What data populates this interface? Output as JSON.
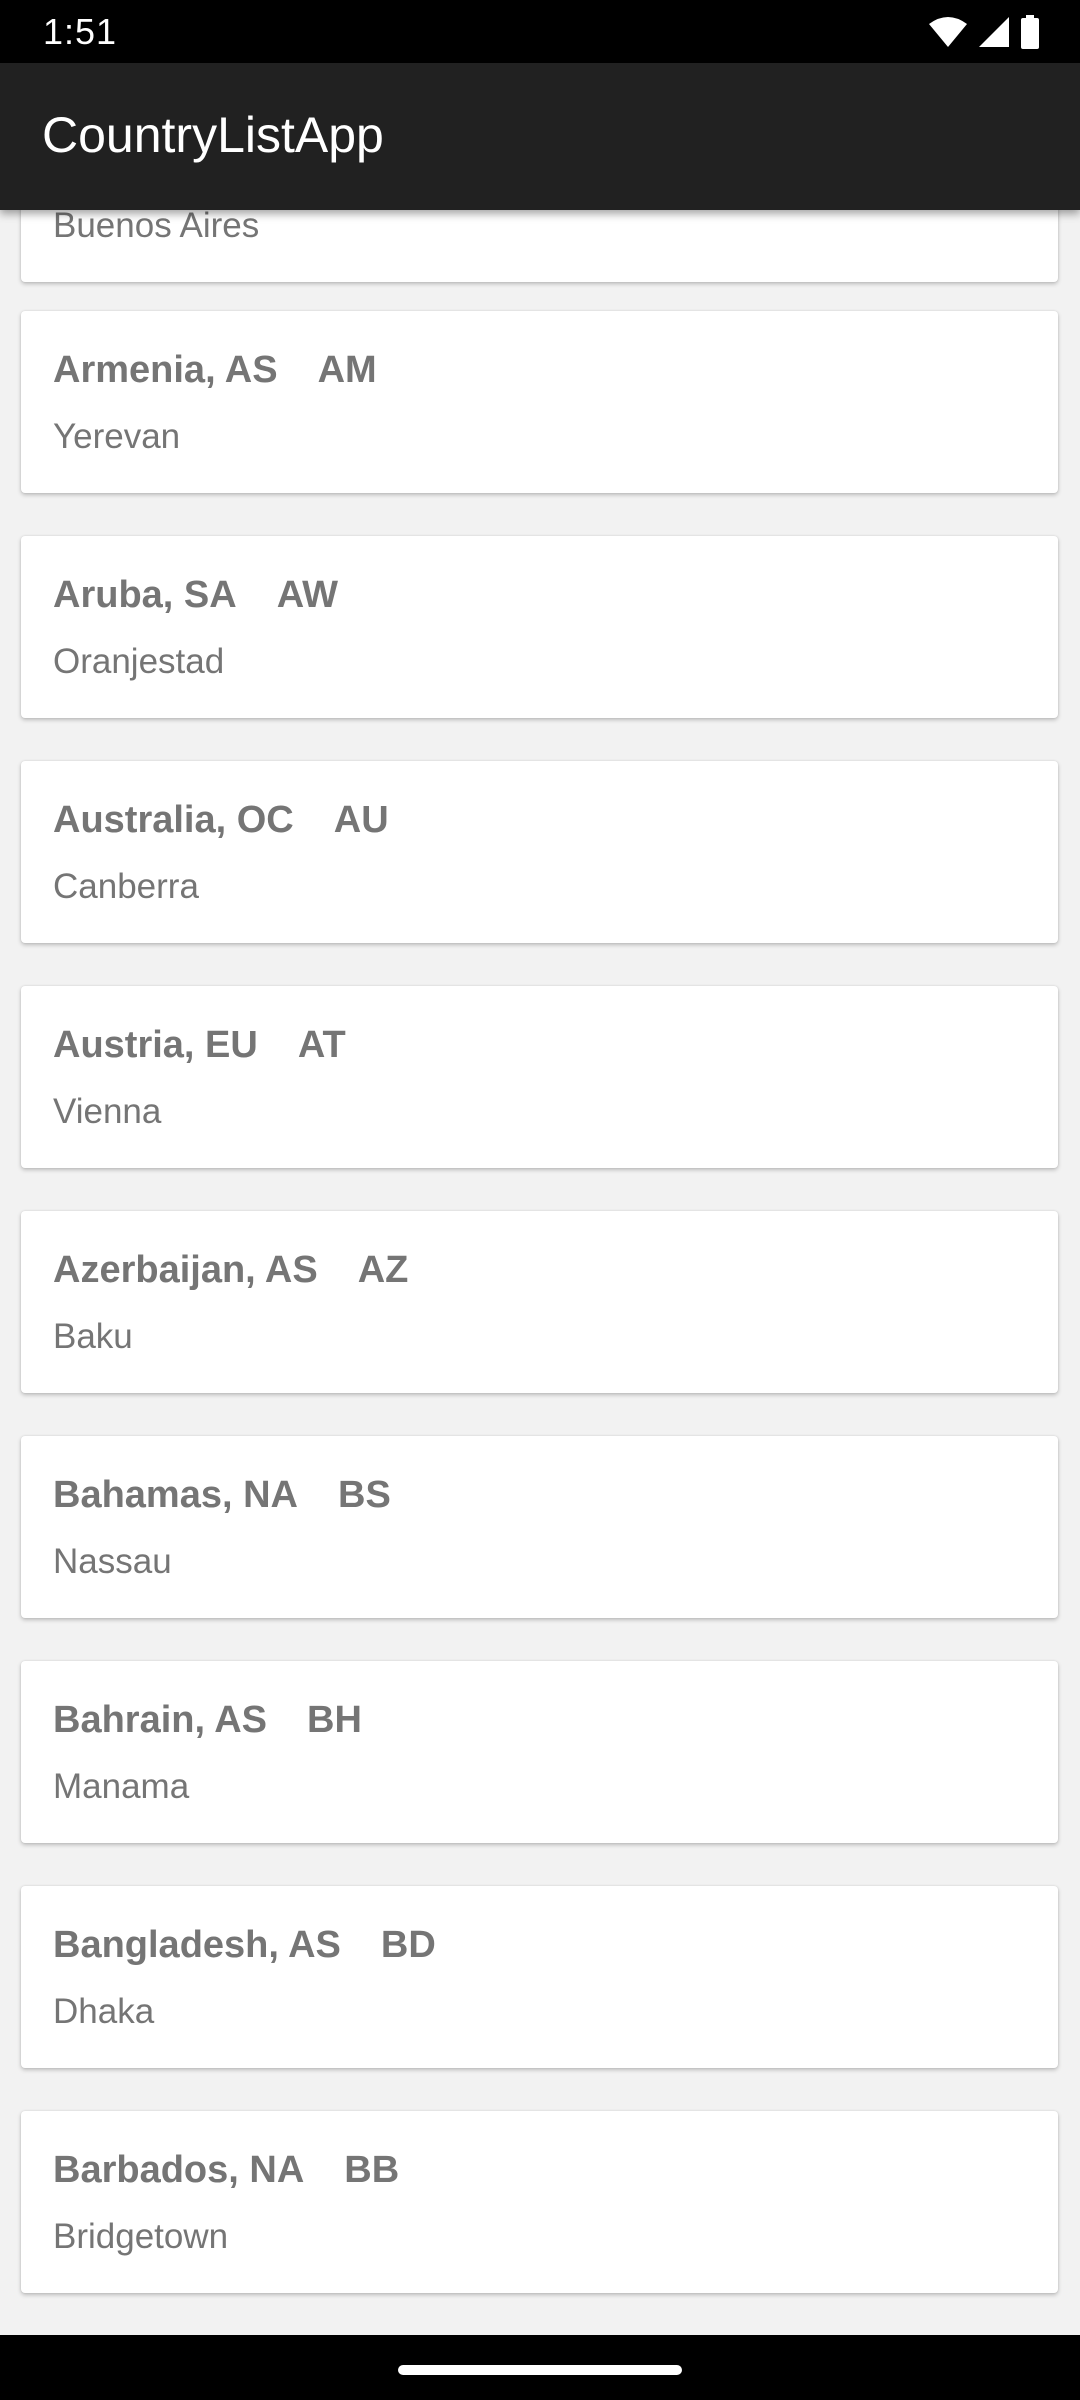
{
  "status_bar": {
    "time": "1:51",
    "icons": [
      "wifi-icon",
      "cellular-signal-icon",
      "battery-icon"
    ]
  },
  "app_bar": {
    "title": "CountryListApp"
  },
  "countries": [
    {
      "name": "",
      "region": "",
      "code": "",
      "capital": "Buenos Aires"
    },
    {
      "name": "Armenia",
      "region": "AS",
      "code": "AM",
      "capital": "Yerevan"
    },
    {
      "name": "Aruba",
      "region": "SA",
      "code": "AW",
      "capital": "Oranjestad"
    },
    {
      "name": "Australia",
      "region": "OC",
      "code": "AU",
      "capital": "Canberra"
    },
    {
      "name": "Austria",
      "region": "EU",
      "code": "AT",
      "capital": "Vienna"
    },
    {
      "name": "Azerbaijan",
      "region": "AS",
      "code": "AZ",
      "capital": "Baku"
    },
    {
      "name": "Bahamas",
      "region": "NA",
      "code": "BS",
      "capital": "Nassau"
    },
    {
      "name": "Bahrain",
      "region": "AS",
      "code": "BH",
      "capital": "Manama"
    },
    {
      "name": "Bangladesh",
      "region": "AS",
      "code": "BD",
      "capital": "Dhaka"
    },
    {
      "name": "Barbados",
      "region": "NA",
      "code": "BB",
      "capital": "Bridgetown"
    }
  ],
  "nav_bar": {
    "home_indicator": "home-pill"
  },
  "colors": {
    "status_bar": "#000000",
    "app_bar": "#212121",
    "background": "#f2f2f2",
    "card": "#ffffff",
    "text": "#757575"
  }
}
